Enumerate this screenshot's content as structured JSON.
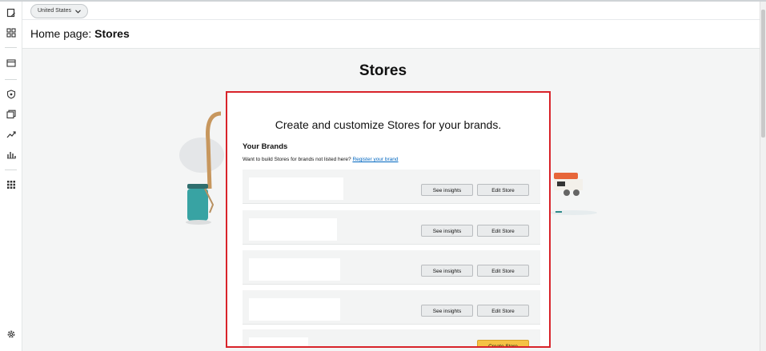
{
  "topbar": {
    "marketplace": "United States"
  },
  "breadcrumb": {
    "prefix": "Home page:",
    "current": "Stores"
  },
  "page": {
    "title": "Stores"
  },
  "panel": {
    "heading": "Create and customize Stores for your brands.",
    "brands_title": "Your Brands",
    "note": "Want to build Stores for brands not listed here?",
    "register_link": "Register your brand",
    "rows": [
      {
        "insights_label": "See insights",
        "edit_label": "Edit Store"
      },
      {
        "insights_label": "See insights",
        "edit_label": "Edit Store"
      },
      {
        "insights_label": "See insights",
        "edit_label": "Edit Store"
      },
      {
        "insights_label": "See insights",
        "edit_label": "Edit Store"
      }
    ],
    "create_label": "Create Store"
  },
  "sidebar": {
    "icons": [
      "bookmark-icon",
      "dashboard-grid-icon",
      "wallet-icon",
      "shield-icon",
      "stack-icon",
      "trend-icon",
      "bar-chart-icon",
      "apps-grid-icon",
      "settings-icon"
    ]
  },
  "colors": {
    "highlight": "#d8232a",
    "primary_button": "#f5c244",
    "link": "#0066c0"
  }
}
